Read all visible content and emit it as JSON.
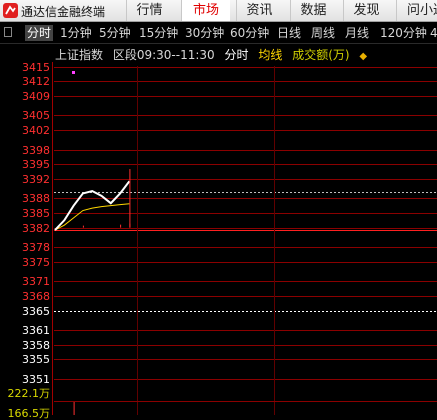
{
  "app": {
    "title": "通达信金融终端"
  },
  "menu": [
    {
      "label": "行情",
      "active": false
    },
    {
      "label": "市场",
      "active": true
    },
    {
      "label": "资讯",
      "active": false
    },
    {
      "label": "数据",
      "active": false
    },
    {
      "label": "发现",
      "active": false
    },
    {
      "label": "问小达",
      "active": false
    }
  ],
  "periods": [
    "分时",
    "1分钟",
    "5分钟",
    "15分钟",
    "30分钟",
    "60分钟",
    "日线",
    "周线",
    "月线",
    "120分钟",
    "4"
  ],
  "active_period": "分时",
  "chart_header": {
    "index_name": "上证指数",
    "range": "区段09:30--11:30",
    "mode": "分时",
    "avg_label": "均线",
    "volume_label": "成交额(万)"
  },
  "price_axis": {
    "ticks": [
      3415,
      3412,
      3409,
      3405,
      3402,
      3398,
      3395,
      3392,
      3388,
      3385,
      3382,
      3378,
      3375,
      3371,
      3368,
      3365,
      3361,
      3358,
      3355,
      3351
    ],
    "reference": 3365
  },
  "volume_axis": {
    "ticks": [
      "222.1万",
      "166.5万"
    ]
  },
  "colors": {
    "up": "#ff3030",
    "down": "#00d0ff",
    "neutral": "#ffffff",
    "avg_line": "#ffd700",
    "grid": "#8b0000"
  },
  "chart_data": {
    "type": "line",
    "series": [
      {
        "name": "分时",
        "values": [
          3381.5,
          3383.5,
          3386.5,
          3389.0,
          3389.5,
          3388.5,
          3387.0,
          3389.0,
          3391.5
        ]
      },
      {
        "name": "均线",
        "values": [
          3381.5,
          3382.5,
          3384.0,
          3385.5,
          3386.0,
          3386.3,
          3386.5,
          3386.7,
          3386.9
        ]
      }
    ],
    "volume": [
      222.0,
      5.0,
      4.0,
      3.5,
      3.0,
      3.0,
      3.0,
      4.0,
      25.0
    ],
    "last_high": 3394.0,
    "last_low": 3382.0,
    "ylim": [
      3349,
      3417
    ]
  }
}
